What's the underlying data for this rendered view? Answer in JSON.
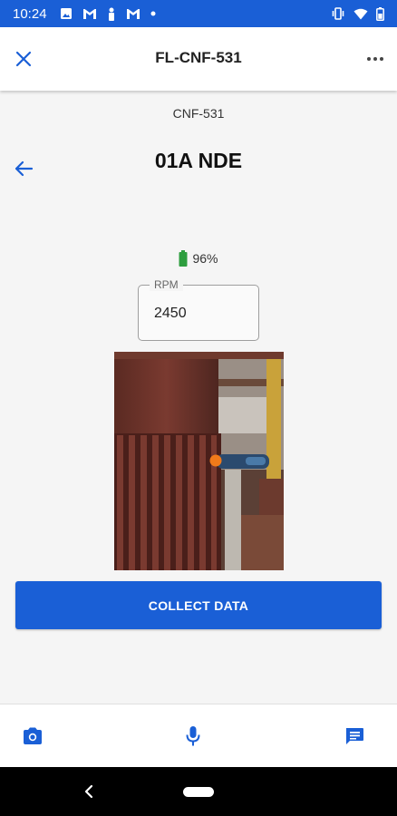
{
  "status_bar": {
    "time": "10:24",
    "left_icons": [
      "image-icon",
      "gmail-icon",
      "person-icon",
      "gmail-icon",
      "dot-icon"
    ],
    "right_icons": [
      "vibrate-icon",
      "wifi-icon",
      "battery-icon"
    ]
  },
  "app_bar": {
    "title": "FL-CNF-531",
    "close_icon": "close-icon",
    "menu_icon": "more-horiz-icon"
  },
  "content": {
    "subtitle": "CNF-531",
    "point_title": "01A NDE",
    "battery_level": "96%",
    "rpm": {
      "label": "RPM",
      "value": "2450"
    },
    "collect_button": "COLLECT DATA"
  },
  "bottom_bar": {
    "items": [
      "camera-icon",
      "microphone-icon",
      "message-icon"
    ]
  },
  "colors": {
    "accent": "#1a5fd6",
    "battery": "#2e9e3f",
    "background": "#f5f5f5"
  }
}
